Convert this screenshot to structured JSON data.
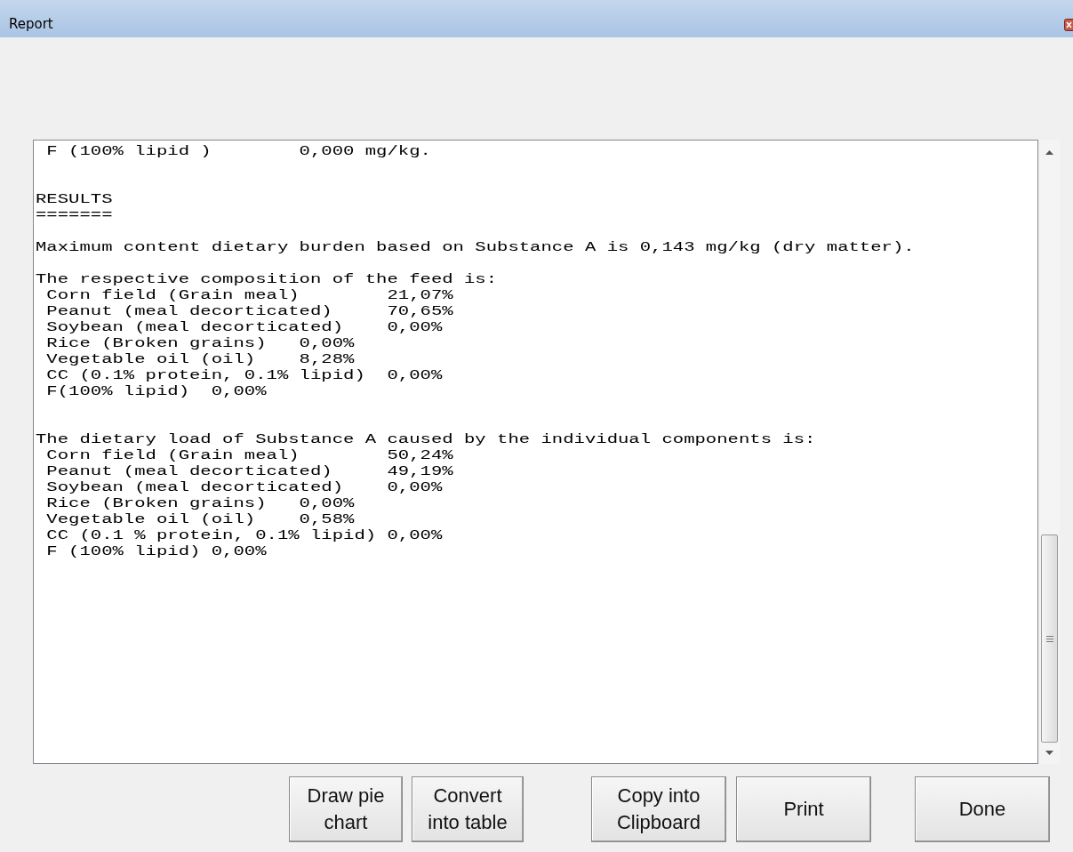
{
  "window": {
    "title": "Report"
  },
  "report": {
    "text": " F (100% lipid )        0,000 mg/kg.\n\n\nRESULTS\n=======\n\nMaximum content dietary burden based on Substance A is 0,143 mg/kg (dry matter).\n\nThe respective composition of the feed is:\n Corn field (Grain meal)        21,07%\n Peanut (meal decorticated)     70,65%\n Soybean (meal decorticated)    0,00%\n Rice (Broken grains)   0,00%\n Vegetable oil (oil)    8,28%\n CC (0.1% protein, 0.1% lipid)  0,00%\n F(100% lipid)  0,00%\n\n\nThe dietary load of Substance A caused by the individual components is:\n Corn field (Grain meal)        50,24%\n Peanut (meal decorticated)     49,19%\n Soybean (meal decorticated)    0,00%\n Rice (Broken grains)   0,00%\n Vegetable oil (oil)    0,58%\n CC (0.1 % protein, 0.1% lipid) 0,00%\n F (100% lipid) 0,00%"
  },
  "buttons": [
    {
      "label": "Draw pie\nchart"
    },
    {
      "label": "Convert\ninto table"
    },
    {
      "label": "Copy into\nClipboard"
    },
    {
      "label": "Print"
    },
    {
      "label": "Done"
    }
  ]
}
